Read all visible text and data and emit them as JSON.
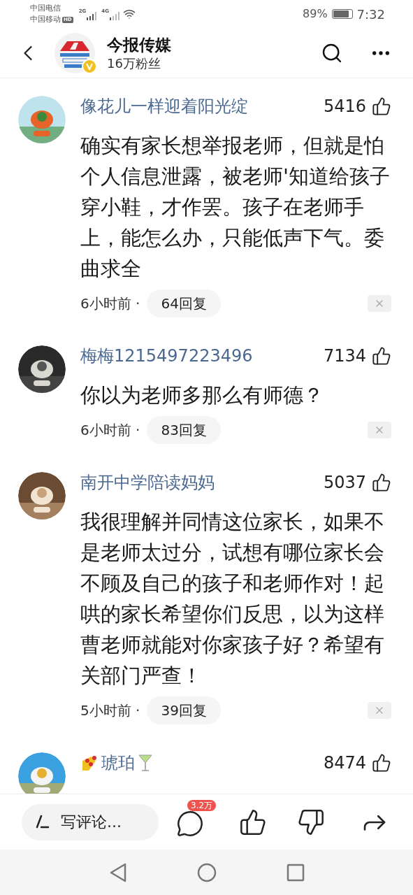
{
  "status_bar": {
    "carrier_1": "中国电信",
    "carrier_2": "中国移动",
    "hd_badge": "HD",
    "signal_1": "2G",
    "signal_2": "4G",
    "battery": "89%",
    "time": "7:32"
  },
  "header": {
    "title": "今报传媒",
    "followers": "16万粉丝",
    "verified": true
  },
  "comments": [
    {
      "user": "像花儿一样迎着阳光绽",
      "likes": "5416",
      "text": "确实有家长想举报老师，但就是怕个人信息泄露，被老师'知道给孩子穿小鞋，才作罢。孩子在老师手上，能怎么办，只能低声下气。委曲求全",
      "time": "6小时前 ·",
      "replies": "64回复"
    },
    {
      "user": "梅梅1215497223496",
      "likes": "7134",
      "text": "你以为老师多那么有师德？",
      "time": "6小时前 ·",
      "replies": "83回复"
    },
    {
      "user": "南开中学陪读妈妈",
      "likes": "5037",
      "text": "我很理解并同情这位家长，如果不是老师太过分，试想有哪位家长会不顾及自己的孩子和老师作对！起哄的家长希望你们反思，以为这样曹老师就能对你家孩子好？希望有关部门严查！",
      "time": "5小时前 ·",
      "replies": "39回复"
    },
    {
      "user": "琥珀",
      "likes": "8474"
    }
  ],
  "bottom_bar": {
    "placeholder": "写评论...",
    "comment_count": "3.2万"
  }
}
